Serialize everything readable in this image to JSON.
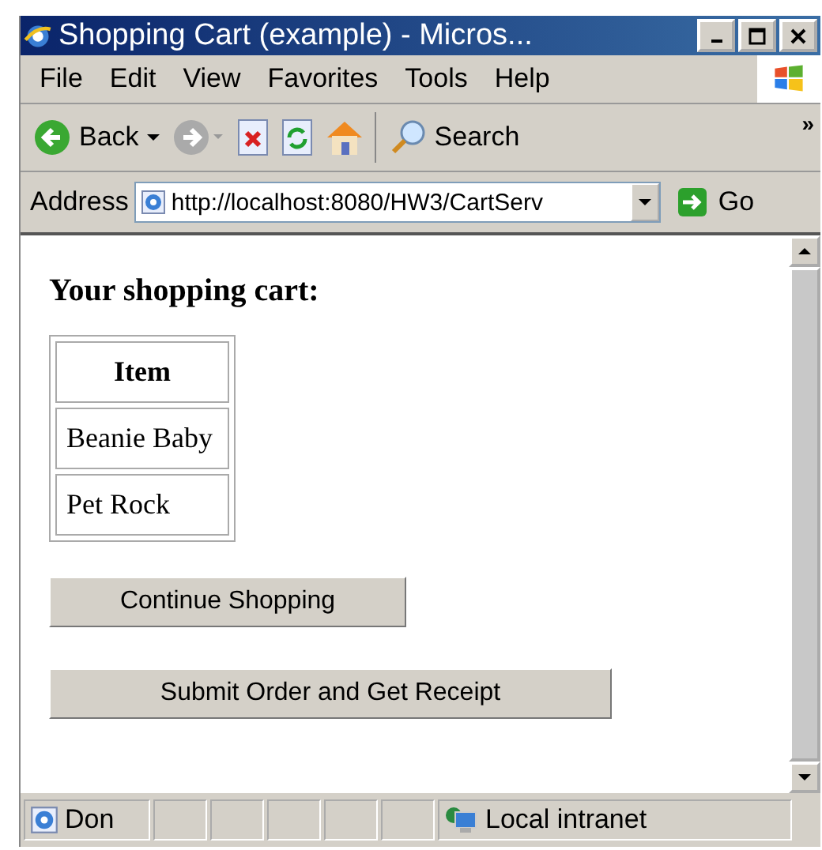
{
  "window": {
    "title": "Shopping Cart (example) - Micros..."
  },
  "menu": [
    "File",
    "Edit",
    "View",
    "Favorites",
    "Tools",
    "Help"
  ],
  "toolbar": {
    "back": "Back",
    "search": "Search",
    "more": "»"
  },
  "address": {
    "label": "Address",
    "value": "http://localhost:8080/HW3/CartServ",
    "go": "Go"
  },
  "page": {
    "heading": "Your shopping cart:",
    "table": {
      "columns": [
        "Item"
      ],
      "rows": [
        [
          "Beanie Baby"
        ],
        [
          "Pet Rock"
        ]
      ]
    },
    "buttons": [
      "Continue Shopping",
      "Submit Order and Get Receipt"
    ]
  },
  "status_bar": {
    "status": "Don",
    "zone": "Local intranet"
  }
}
